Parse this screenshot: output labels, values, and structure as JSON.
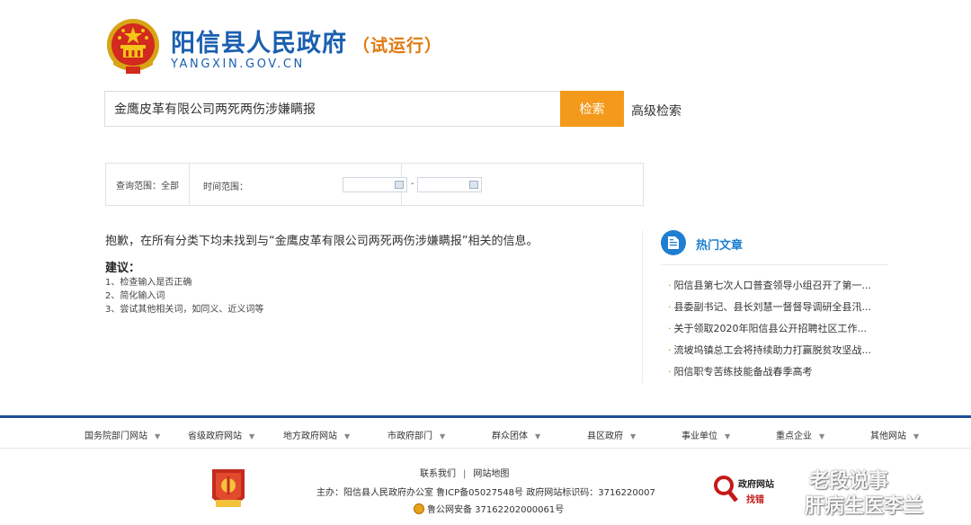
{
  "header": {
    "title": "阳信县人民政府",
    "trial": "（试运行）",
    "domain": "YANGXIN.GOV.CN"
  },
  "search": {
    "query": "金鹰皮革有限公司两死两伤涉嫌瞒报",
    "button_label": "检索",
    "advanced_label": "高级检索"
  },
  "filters": {
    "scope_label": "查询范围：全部",
    "time_label": "时间范围：",
    "separator": "-"
  },
  "results": {
    "no_result_text": "抱歉，在所有分类下均未找到与“金鹰皮革有限公司两死两伤涉嫌瞒报”相关的信息。",
    "suggest_title": "建议：",
    "suggestions": [
      "1、检查输入是否正确",
      "2、简化输入词",
      "3、尝试其他相关词，如同义、近义词等"
    ]
  },
  "hot": {
    "title": "热门文章",
    "icon": "document-icon",
    "items": [
      "阳信县第七次人口普查领导小组召开了第一...",
      "县委副书记、县长刘慧一督督导调研全县汛...",
      "关于领取2020年阳信县公开招聘社区工作...",
      "流坡坞镇总工会将持续助力打赢脱贫攻坚战...",
      "阳信职专苦练技能备战春季高考"
    ]
  },
  "nav": {
    "items": [
      "国务院部门网站",
      "省级政府网站",
      "地方政府网站",
      "市政府部门",
      "群众团体",
      "县区政府",
      "事业单位",
      "重点企业",
      "其他网站"
    ],
    "arrow": "▼"
  },
  "footer": {
    "contact": "联系我们",
    "sitemap": "网站地图",
    "link_sep": "|",
    "host": "主办：阳信县人民政府办公室 鲁ICP备05027548号 政府网站标识码：3716220007",
    "police": "鲁公网安备 37162202000061号",
    "badge_text": "党政机关",
    "gov_mark_1": "政府网站",
    "gov_mark_2": "找错"
  },
  "watermark": {
    "line1": "老段说事",
    "line2": "肝病生医李兰"
  },
  "colors": {
    "brand_blue": "#1a5fb0",
    "accent_orange": "#f39a1c",
    "nav_blue": "#1d4f9a"
  }
}
